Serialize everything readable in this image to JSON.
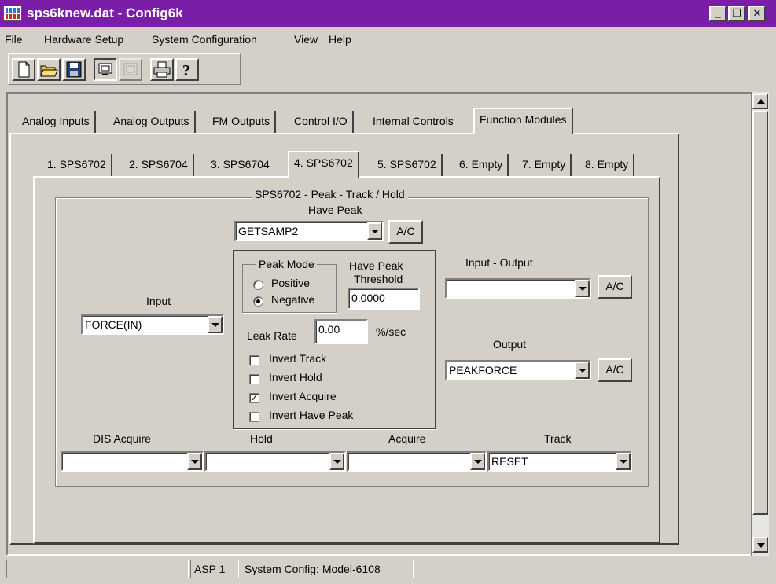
{
  "window": {
    "title": "sps6knew.dat - Config6k"
  },
  "menu": [
    "File",
    "Hardware Setup",
    "System Configuration",
    "View",
    "Help"
  ],
  "toolbar": [
    "new-file-icon",
    "open-folder-icon",
    "save-disk-icon",
    "monitor-icon",
    "disabled-panel-icon",
    "printer-icon",
    "help-icon"
  ],
  "outer_tabs": [
    "Analog Inputs",
    "Analog Outputs",
    "FM Outputs",
    "Control I/O",
    "Internal Controls",
    "Function Modules"
  ],
  "outer_tabs_active": "Function Modules",
  "inner_tabs": [
    "1. SPS6702",
    "2. SPS6704",
    "3. SPS6704",
    "4. SPS6702",
    "5. SPS6702",
    "6. Empty",
    "7. Empty",
    "8. Empty"
  ],
  "inner_tabs_active": "4. SPS6702",
  "module": {
    "title": "SPS6702 - Peak - Track / Hold",
    "have_peak_label": "Have Peak",
    "have_peak_value": "GETSAMP2",
    "ac_label": "A/C",
    "input_label": "Input",
    "input_value": "FORCE(IN)",
    "peak_mode_label": "Peak Mode",
    "positive_label": "Positive",
    "negative_label": "Negative",
    "peak_mode_selected": "Negative",
    "threshold_label_1": "Have Peak",
    "threshold_label_2": "Threshold",
    "threshold_value": "0.0000",
    "leak_rate_label": "Leak Rate",
    "leak_rate_value": "0.00",
    "leak_rate_unit": "%/sec",
    "checkboxes": [
      {
        "label": "Invert Track",
        "checked": false
      },
      {
        "label": "Invert Hold",
        "checked": false
      },
      {
        "label": "Invert Acquire",
        "checked": true
      },
      {
        "label": "Invert Have Peak",
        "checked": false
      }
    ],
    "input_output_label": "Input - Output",
    "input_output_value": "",
    "output_label": "Output",
    "output_value": "PEAKFORCE",
    "dis_acquire_label": "DIS Acquire",
    "dis_acquire_value": "",
    "hold_label": "Hold",
    "hold_value": "",
    "acquire_label": "Acquire",
    "acquire_value": "",
    "track_label": "Track",
    "track_value": "RESET"
  },
  "status": {
    "pane2": "ASP 1",
    "pane3": "System Config: Model-6108"
  }
}
